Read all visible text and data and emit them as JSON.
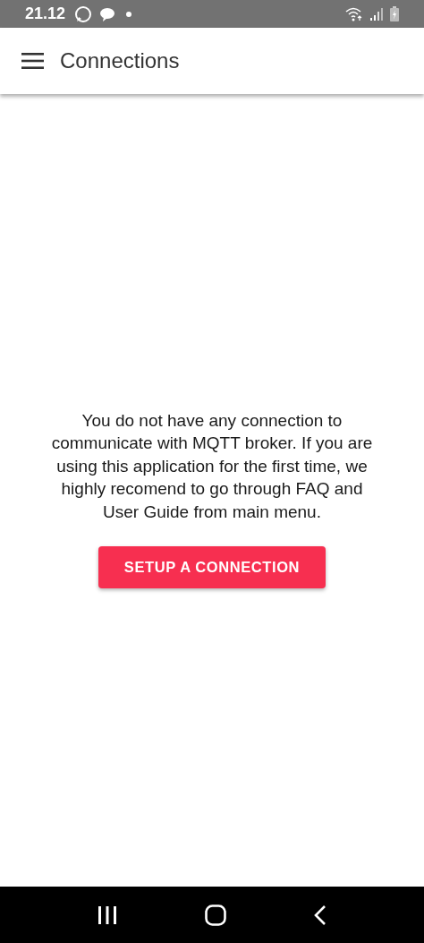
{
  "status_bar": {
    "time": "21.12"
  },
  "app_bar": {
    "title": "Connections"
  },
  "empty_state": {
    "message": "You do not have any connection to communicate with MQTT broker. If you are using this application for the first time, we highly recomend to go through FAQ and User Guide from main menu.",
    "button": "SETUP A CONNECTION"
  }
}
